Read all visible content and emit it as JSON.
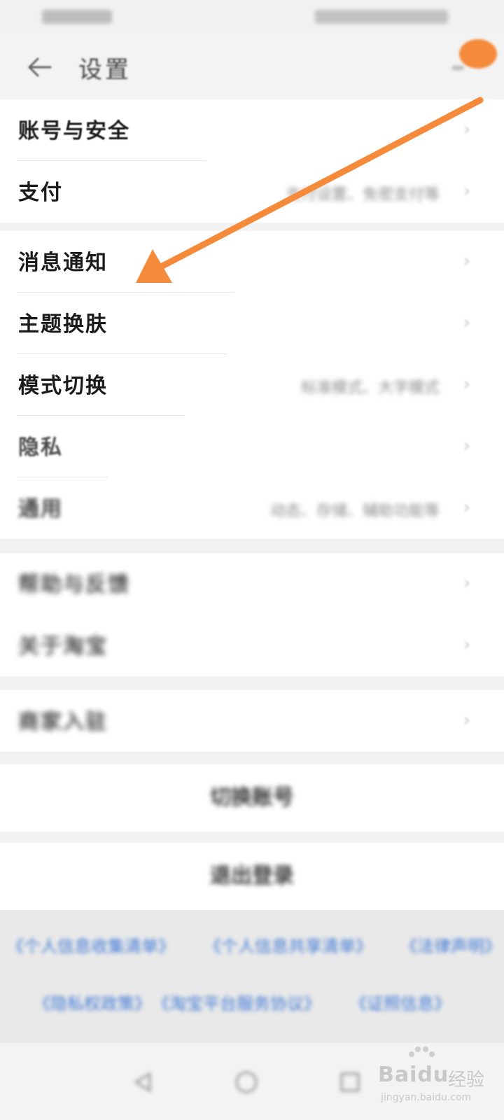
{
  "header": {
    "title": "设置"
  },
  "groups": [
    {
      "items": [
        {
          "label": "账号与安全",
          "subtitle": ""
        },
        {
          "label": "支付",
          "subtitle": "支付设置、免密支付等"
        }
      ]
    },
    {
      "items": [
        {
          "label": "消息通知",
          "subtitle": ""
        },
        {
          "label": "主题换肤",
          "subtitle": ""
        },
        {
          "label": "模式切换",
          "subtitle": "标准模式、大字模式"
        },
        {
          "label": "隐私",
          "subtitle": ""
        },
        {
          "label": "通用",
          "subtitle": "动态、存储、辅助功能等"
        }
      ]
    },
    {
      "items": [
        {
          "label": "帮助与反馈",
          "subtitle": ""
        },
        {
          "label": "关于淘宝",
          "subtitle": ""
        }
      ]
    },
    {
      "items": [
        {
          "label": "商家入驻",
          "subtitle": ""
        }
      ]
    }
  ],
  "actions": {
    "switch_account": "切换账号",
    "logout": "退出登录"
  },
  "footer_links": [
    "《个人信息收集清单》",
    "《个人信息共享清单》",
    "《法律声明》",
    "《隐私权政策》",
    "《淘宝平台服务协议》",
    "《证照信息》"
  ],
  "icons": {
    "back": "arrow-left-icon",
    "chevron": "chevron-right-icon",
    "nav": [
      "nav-back-icon",
      "nav-home-icon",
      "nav-recent-icon"
    ]
  },
  "colors": {
    "annotation": "#f58a3a",
    "link": "#3d78d6"
  },
  "watermark": {
    "brand": "Baidu",
    "cn": "经验",
    "url": "jingyan.baidu.com"
  }
}
